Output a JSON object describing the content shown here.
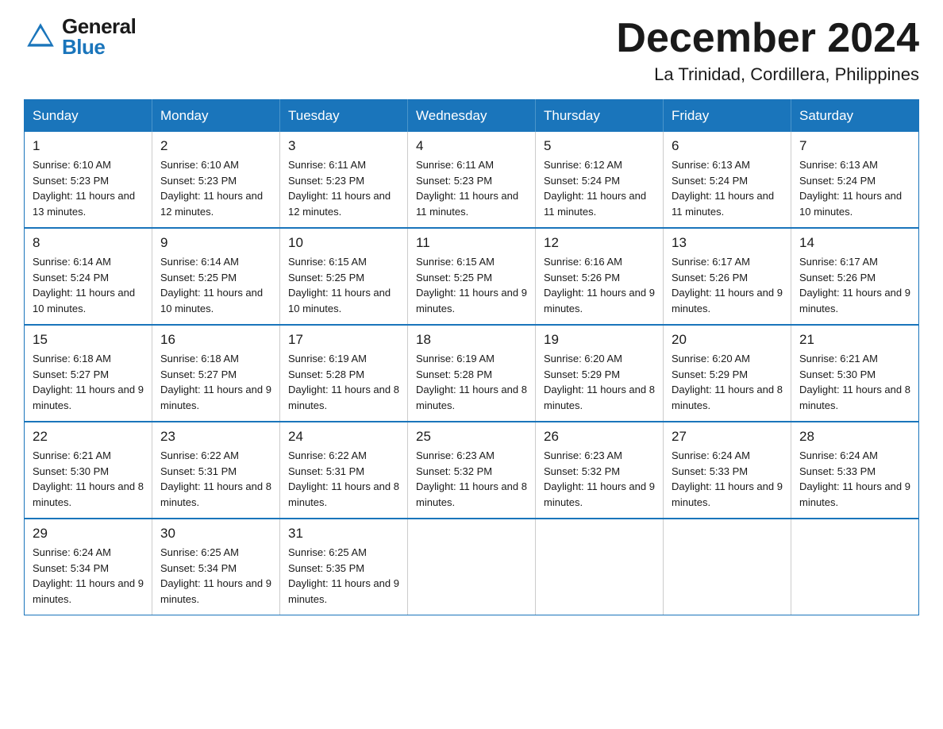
{
  "header": {
    "logo_general": "General",
    "logo_blue": "Blue",
    "month_title": "December 2024",
    "location": "La Trinidad, Cordillera, Philippines"
  },
  "days_of_week": [
    "Sunday",
    "Monday",
    "Tuesday",
    "Wednesday",
    "Thursday",
    "Friday",
    "Saturday"
  ],
  "weeks": [
    [
      {
        "day": "1",
        "sunrise": "Sunrise: 6:10 AM",
        "sunset": "Sunset: 5:23 PM",
        "daylight": "Daylight: 11 hours and 13 minutes."
      },
      {
        "day": "2",
        "sunrise": "Sunrise: 6:10 AM",
        "sunset": "Sunset: 5:23 PM",
        "daylight": "Daylight: 11 hours and 12 minutes."
      },
      {
        "day": "3",
        "sunrise": "Sunrise: 6:11 AM",
        "sunset": "Sunset: 5:23 PM",
        "daylight": "Daylight: 11 hours and 12 minutes."
      },
      {
        "day": "4",
        "sunrise": "Sunrise: 6:11 AM",
        "sunset": "Sunset: 5:23 PM",
        "daylight": "Daylight: 11 hours and 11 minutes."
      },
      {
        "day": "5",
        "sunrise": "Sunrise: 6:12 AM",
        "sunset": "Sunset: 5:24 PM",
        "daylight": "Daylight: 11 hours and 11 minutes."
      },
      {
        "day": "6",
        "sunrise": "Sunrise: 6:13 AM",
        "sunset": "Sunset: 5:24 PM",
        "daylight": "Daylight: 11 hours and 11 minutes."
      },
      {
        "day": "7",
        "sunrise": "Sunrise: 6:13 AM",
        "sunset": "Sunset: 5:24 PM",
        "daylight": "Daylight: 11 hours and 10 minutes."
      }
    ],
    [
      {
        "day": "8",
        "sunrise": "Sunrise: 6:14 AM",
        "sunset": "Sunset: 5:24 PM",
        "daylight": "Daylight: 11 hours and 10 minutes."
      },
      {
        "day": "9",
        "sunrise": "Sunrise: 6:14 AM",
        "sunset": "Sunset: 5:25 PM",
        "daylight": "Daylight: 11 hours and 10 minutes."
      },
      {
        "day": "10",
        "sunrise": "Sunrise: 6:15 AM",
        "sunset": "Sunset: 5:25 PM",
        "daylight": "Daylight: 11 hours and 10 minutes."
      },
      {
        "day": "11",
        "sunrise": "Sunrise: 6:15 AM",
        "sunset": "Sunset: 5:25 PM",
        "daylight": "Daylight: 11 hours and 9 minutes."
      },
      {
        "day": "12",
        "sunrise": "Sunrise: 6:16 AM",
        "sunset": "Sunset: 5:26 PM",
        "daylight": "Daylight: 11 hours and 9 minutes."
      },
      {
        "day": "13",
        "sunrise": "Sunrise: 6:17 AM",
        "sunset": "Sunset: 5:26 PM",
        "daylight": "Daylight: 11 hours and 9 minutes."
      },
      {
        "day": "14",
        "sunrise": "Sunrise: 6:17 AM",
        "sunset": "Sunset: 5:26 PM",
        "daylight": "Daylight: 11 hours and 9 minutes."
      }
    ],
    [
      {
        "day": "15",
        "sunrise": "Sunrise: 6:18 AM",
        "sunset": "Sunset: 5:27 PM",
        "daylight": "Daylight: 11 hours and 9 minutes."
      },
      {
        "day": "16",
        "sunrise": "Sunrise: 6:18 AM",
        "sunset": "Sunset: 5:27 PM",
        "daylight": "Daylight: 11 hours and 9 minutes."
      },
      {
        "day": "17",
        "sunrise": "Sunrise: 6:19 AM",
        "sunset": "Sunset: 5:28 PM",
        "daylight": "Daylight: 11 hours and 8 minutes."
      },
      {
        "day": "18",
        "sunrise": "Sunrise: 6:19 AM",
        "sunset": "Sunset: 5:28 PM",
        "daylight": "Daylight: 11 hours and 8 minutes."
      },
      {
        "day": "19",
        "sunrise": "Sunrise: 6:20 AM",
        "sunset": "Sunset: 5:29 PM",
        "daylight": "Daylight: 11 hours and 8 minutes."
      },
      {
        "day": "20",
        "sunrise": "Sunrise: 6:20 AM",
        "sunset": "Sunset: 5:29 PM",
        "daylight": "Daylight: 11 hours and 8 minutes."
      },
      {
        "day": "21",
        "sunrise": "Sunrise: 6:21 AM",
        "sunset": "Sunset: 5:30 PM",
        "daylight": "Daylight: 11 hours and 8 minutes."
      }
    ],
    [
      {
        "day": "22",
        "sunrise": "Sunrise: 6:21 AM",
        "sunset": "Sunset: 5:30 PM",
        "daylight": "Daylight: 11 hours and 8 minutes."
      },
      {
        "day": "23",
        "sunrise": "Sunrise: 6:22 AM",
        "sunset": "Sunset: 5:31 PM",
        "daylight": "Daylight: 11 hours and 8 minutes."
      },
      {
        "day": "24",
        "sunrise": "Sunrise: 6:22 AM",
        "sunset": "Sunset: 5:31 PM",
        "daylight": "Daylight: 11 hours and 8 minutes."
      },
      {
        "day": "25",
        "sunrise": "Sunrise: 6:23 AM",
        "sunset": "Sunset: 5:32 PM",
        "daylight": "Daylight: 11 hours and 8 minutes."
      },
      {
        "day": "26",
        "sunrise": "Sunrise: 6:23 AM",
        "sunset": "Sunset: 5:32 PM",
        "daylight": "Daylight: 11 hours and 9 minutes."
      },
      {
        "day": "27",
        "sunrise": "Sunrise: 6:24 AM",
        "sunset": "Sunset: 5:33 PM",
        "daylight": "Daylight: 11 hours and 9 minutes."
      },
      {
        "day": "28",
        "sunrise": "Sunrise: 6:24 AM",
        "sunset": "Sunset: 5:33 PM",
        "daylight": "Daylight: 11 hours and 9 minutes."
      }
    ],
    [
      {
        "day": "29",
        "sunrise": "Sunrise: 6:24 AM",
        "sunset": "Sunset: 5:34 PM",
        "daylight": "Daylight: 11 hours and 9 minutes."
      },
      {
        "day": "30",
        "sunrise": "Sunrise: 6:25 AM",
        "sunset": "Sunset: 5:34 PM",
        "daylight": "Daylight: 11 hours and 9 minutes."
      },
      {
        "day": "31",
        "sunrise": "Sunrise: 6:25 AM",
        "sunset": "Sunset: 5:35 PM",
        "daylight": "Daylight: 11 hours and 9 minutes."
      },
      null,
      null,
      null,
      null
    ]
  ]
}
